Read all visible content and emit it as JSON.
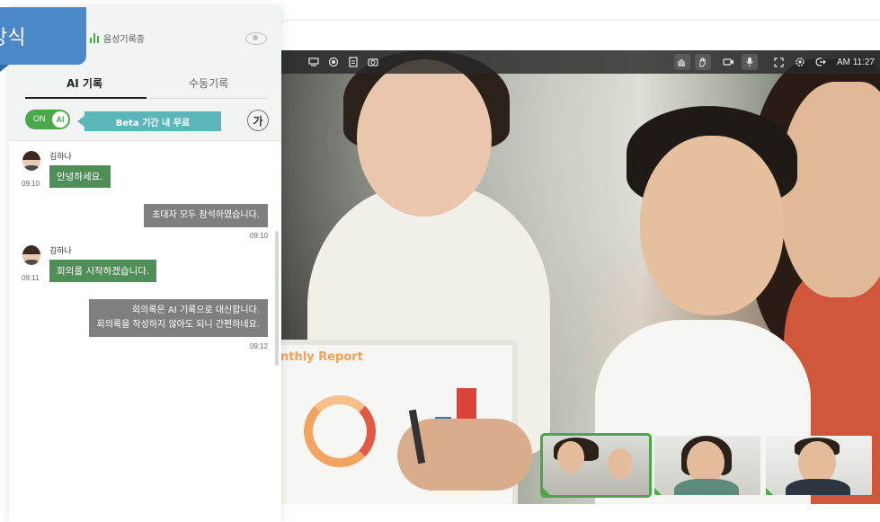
{
  "panel": {
    "tag_label": "방식",
    "recording_label": "음성기록중",
    "tabs": [
      {
        "label": "AI 기록",
        "active": true
      },
      {
        "label": "수동기록",
        "active": false
      }
    ],
    "toggle": {
      "state_label": "ON",
      "knob_label": "AI"
    },
    "beta_banner": "Beta 기간 내 무료",
    "font_button": "가"
  },
  "messages": [
    {
      "sender": "김하나",
      "time": "09:10",
      "text": "안녕하세요.",
      "side": "left"
    },
    {
      "text": "초대자 모두 참석하였습니다.",
      "time": "09:10",
      "side": "right"
    },
    {
      "sender": "김하나",
      "time": "09:11",
      "text": "회의를 시작하겠습니다.",
      "side": "left"
    },
    {
      "lines": [
        "회의록은 AI 기록으로 대신합니다.",
        "회의록을 작성하지 않아도 되니 간편하네요."
      ],
      "time": "09:12",
      "side": "right"
    }
  ],
  "toolbar": {
    "time": "AM 11:27"
  },
  "video": {
    "slide_title": "nthly Report"
  },
  "colors": {
    "accent_green": "#4aa84a",
    "tag_blue": "#4a88c7",
    "beta_teal": "#5cb5b9",
    "bubble_green": "#4f8f57",
    "bubble_gray": "#7f7f7f"
  }
}
